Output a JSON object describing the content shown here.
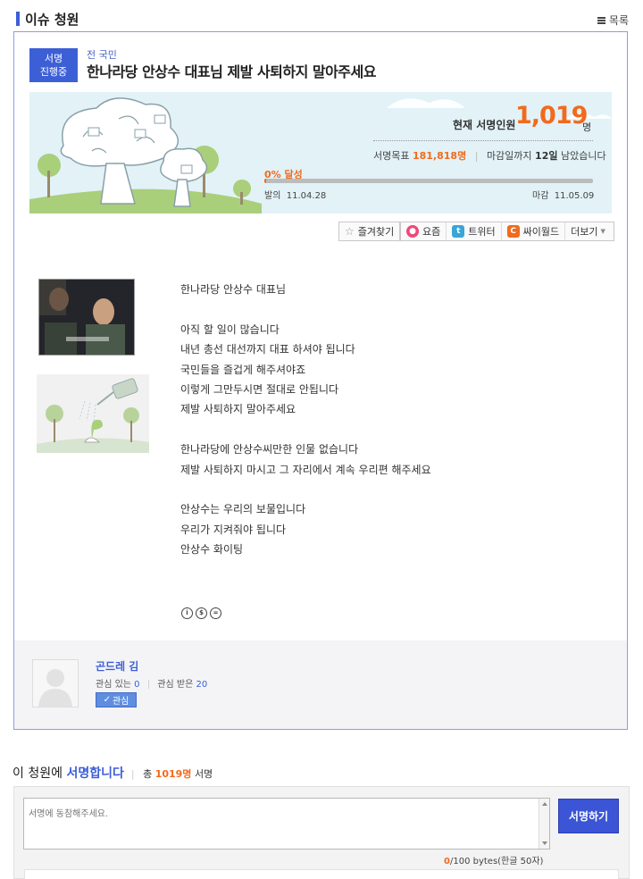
{
  "header": {
    "title": "이슈 청원",
    "list_label": "목록"
  },
  "petition": {
    "status_line1": "서명",
    "status_line2": "진행중",
    "category": "전 국민",
    "title": "한나라당 안상수 대표님 제발 사퇴하지 말아주세요",
    "count_label": "현재 서명인원",
    "count_value": "1,019",
    "count_unit": "명",
    "goal_label": "서명목표",
    "goal_value": "181,818명",
    "deadline_prefix": "마감일까지",
    "deadline_value": "12일",
    "deadline_suffix": "남았습니다",
    "progress_label": "0% 달성",
    "progress_fraction": 0.0056,
    "start_label": "발의",
    "start_date": "11.04.28",
    "end_label": "마감",
    "end_date": "11.05.09"
  },
  "toolbar": {
    "bookmark": "즐겨찾기",
    "yozm": "요즘",
    "twitter": "트위터",
    "cyworld": "싸이월드",
    "more": "더보기"
  },
  "body": {
    "lines": [
      "한나라당 안상수 대표님",
      "",
      "아직 할 일이 많습니다",
      "내년 총선 대선까지 대표 하셔야 됩니다",
      "국민들을 즐겁게 해주셔야죠",
      "이렇게 그만두시면 절대로 안됩니다",
      "제발 사퇴하지 말아주세요",
      "",
      "한나라당에 안상수씨만한 인물 없습니다",
      "제발 사퇴하지 마시고 그 자리에서 계속 우리편 해주세요",
      "",
      "안상수는 우리의 보물입니다",
      "우리가 지켜줘야 됩니다",
      "안상수 화이팅"
    ]
  },
  "author": {
    "name": "곤드레 김",
    "following_label": "관심 있는",
    "following_count": "0",
    "followers_label": "관심 받은",
    "followers_count": "20",
    "follow_button": "관심"
  },
  "sign": {
    "heading_prefix": "이 청원에",
    "heading_highlight": "서명합니다",
    "total_prefix": "총",
    "total_count": "1019명",
    "total_suffix": "서명",
    "placeholder": "서명에 동참해주세요.",
    "button": "서명하기",
    "byte_current": "0",
    "byte_rest": "/100 bytes(한글 50자)"
  },
  "colors": {
    "accent": "#3d5fd6",
    "highlight": "#f26a1b",
    "banner_bg": "#e2f2f7"
  }
}
